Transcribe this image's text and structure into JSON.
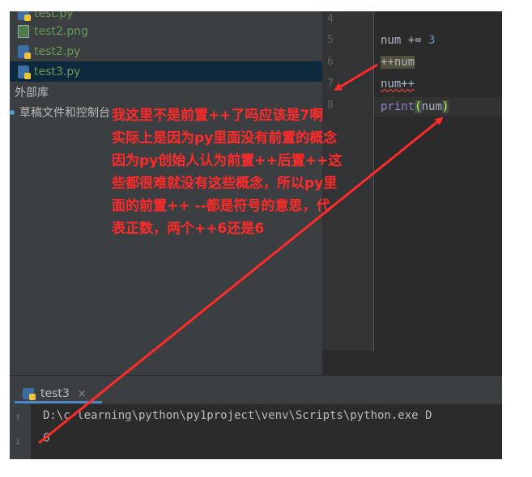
{
  "project_tree": {
    "items": [
      {
        "label": "test.py",
        "icon": "python-file-icon"
      },
      {
        "label": "test2.png",
        "icon": "image-file-icon"
      },
      {
        "label": "test2.py",
        "icon": "python-file-icon"
      },
      {
        "label": "test3.py",
        "icon": "python-file-icon"
      },
      {
        "label": "外部库",
        "icon": "library-icon"
      },
      {
        "label": "草稿文件和控制台",
        "icon": "scratches-icon"
      }
    ]
  },
  "gutter": {
    "lines": [
      "4",
      "5",
      "6",
      "7",
      "8"
    ]
  },
  "editor": {
    "line5": {
      "var": "num",
      "op": " += ",
      "val": "3"
    },
    "line6": "++num",
    "line7": "num++",
    "line8": {
      "fn": "print",
      "open": "(",
      "arg": "num",
      "close": ")"
    }
  },
  "run_panel": {
    "tab_label": "test3",
    "close_glyph": "×",
    "up_glyph": "↑",
    "down_glyph": "↓",
    "console_lines": [
      "D:\\c-learning\\python\\py1project\\venv\\Scripts\\python.exe D",
      "6"
    ]
  },
  "annotation": {
    "lines": [
      "我这里不是前置++了吗应该是7啊",
      "实际上是因为py里面没有前置的概念",
      "因为py创始人认为前置++后置++这",
      "些都很难就没有这些概念，所以py里",
      "面的前置++ --都是符号的意思，代",
      "表正数，两个++6还是6"
    ],
    "color": "#ff2a2a"
  },
  "colors": {
    "ide_bg": "#2b2b2b",
    "panel_bg": "#3c3f41",
    "selection": "#0d293e",
    "accent": "#4a88c7"
  }
}
